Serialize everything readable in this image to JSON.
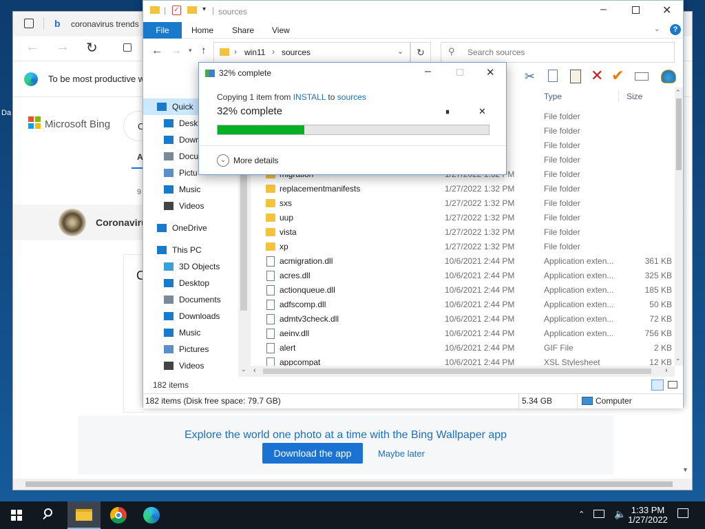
{
  "browser": {
    "tab_title": "coronavirus trends",
    "info_bar_text": "To be most productive w",
    "bing_logo_text": "Microsoft Bing",
    "search_peek": "C",
    "tab_peek": "Al",
    "count_peek": "9",
    "entity_text": "Coronaviru",
    "card_peek": "C",
    "banner_text": "Explore the world one photo at a time with the Bing Wallpaper app",
    "download_label": "Download the app",
    "maybe_later_label": "Maybe later",
    "desktop_label": "Da"
  },
  "explorer": {
    "title": "sources",
    "ribbon_tabs": [
      "File",
      "Home",
      "Share",
      "View"
    ],
    "breadcrumb": [
      "win11",
      "sources"
    ],
    "search_placeholder": "Search sources",
    "nav_items": [
      {
        "label": "Quick",
        "icon": "star-icon",
        "color": "#1979ca"
      },
      {
        "label": "Deskt",
        "icon": "desktop-icon",
        "color": "#1979ca"
      },
      {
        "label": "Down",
        "icon": "download-icon",
        "color": "#1979ca"
      },
      {
        "label": "Docu",
        "icon": "documents-icon",
        "color": "#7a8a9a"
      },
      {
        "label": "Pictu",
        "icon": "pictures-icon",
        "color": "#5b8fc7"
      },
      {
        "label": "Music",
        "icon": "music-icon",
        "color": "#1979ca"
      },
      {
        "label": "Videos",
        "icon": "videos-icon",
        "color": "#444"
      },
      {
        "label": "OneDrive",
        "icon": "onedrive-icon",
        "color": "#1979ca"
      },
      {
        "label": "This PC",
        "icon": "this-pc-icon",
        "color": "#1979ca"
      },
      {
        "label": "3D Objects",
        "icon": "3d-objects-icon",
        "color": "#3ba0d6"
      },
      {
        "label": "Desktop",
        "icon": "desktop-icon",
        "color": "#1979ca"
      },
      {
        "label": "Documents",
        "icon": "documents-icon",
        "color": "#7a8a9a"
      },
      {
        "label": "Downloads",
        "icon": "download-icon",
        "color": "#1979ca"
      },
      {
        "label": "Music",
        "icon": "music-icon",
        "color": "#1979ca"
      },
      {
        "label": "Pictures",
        "icon": "pictures-icon",
        "color": "#5b8fc7"
      },
      {
        "label": "Videos",
        "icon": "videos-icon",
        "color": "#444"
      }
    ],
    "columns": {
      "type": "Type",
      "size": "Size"
    },
    "rows": [
      {
        "name": "",
        "date": "",
        "type": "File folder",
        "size": "",
        "kind": "folder"
      },
      {
        "name": "",
        "date": "",
        "type": "File folder",
        "size": "",
        "kind": "folder"
      },
      {
        "name": "",
        "date": "",
        "type": "File folder",
        "size": "",
        "kind": "folder"
      },
      {
        "name": "",
        "date": "",
        "type": "File folder",
        "size": "",
        "kind": "folder"
      },
      {
        "name": "migration",
        "date": "1/27/2022 1:32 PM",
        "type": "File folder",
        "size": "",
        "kind": "folder"
      },
      {
        "name": "replacementmanifests",
        "date": "1/27/2022 1:32 PM",
        "type": "File folder",
        "size": "",
        "kind": "folder"
      },
      {
        "name": "sxs",
        "date": "1/27/2022 1:32 PM",
        "type": "File folder",
        "size": "",
        "kind": "folder"
      },
      {
        "name": "uup",
        "date": "1/27/2022 1:32 PM",
        "type": "File folder",
        "size": "",
        "kind": "folder"
      },
      {
        "name": "vista",
        "date": "1/27/2022 1:32 PM",
        "type": "File folder",
        "size": "",
        "kind": "folder"
      },
      {
        "name": "xp",
        "date": "1/27/2022 1:32 PM",
        "type": "File folder",
        "size": "",
        "kind": "folder"
      },
      {
        "name": "acmigration.dll",
        "date": "10/6/2021 2:44 PM",
        "type": "Application exten...",
        "size": "361 KB",
        "kind": "dll"
      },
      {
        "name": "acres.dll",
        "date": "10/6/2021 2:44 PM",
        "type": "Application exten...",
        "size": "325 KB",
        "kind": "dll"
      },
      {
        "name": "actionqueue.dll",
        "date": "10/6/2021 2:44 PM",
        "type": "Application exten...",
        "size": "185 KB",
        "kind": "dll"
      },
      {
        "name": "adfscomp.dll",
        "date": "10/6/2021 2:44 PM",
        "type": "Application exten...",
        "size": "50 KB",
        "kind": "dll"
      },
      {
        "name": "admtv3check.dll",
        "date": "10/6/2021 2:44 PM",
        "type": "Application exten...",
        "size": "72 KB",
        "kind": "dll"
      },
      {
        "name": "aeinv.dll",
        "date": "10/6/2021 2:44 PM",
        "type": "Application exten...",
        "size": "756 KB",
        "kind": "dll"
      },
      {
        "name": "alert",
        "date": "10/6/2021 2:44 PM",
        "type": "GIF File",
        "size": "2 KB",
        "kind": "gif"
      },
      {
        "name": "appcompat",
        "date": "10/6/2021 2:44 PM",
        "type": "XSL Stylesheet",
        "size": "12 KB",
        "kind": "xsl"
      }
    ],
    "item_count": "182 items",
    "status_free": "182 items (Disk free space: 79.7 GB)",
    "status_size": "5.34 GB",
    "status_location": "Computer"
  },
  "copy_dialog": {
    "title": "32% complete",
    "source_prefix": "Copying 1 item from ",
    "source": "INSTALL",
    "to_word": " to ",
    "destination": "sources",
    "percent_text": "32% complete",
    "progress": 0.32,
    "more_details": "More details"
  },
  "taskbar": {
    "time": "1:33 PM",
    "date": "1/27/2022"
  },
  "colors": {
    "accent": "#1979ca",
    "progress": "#06b025",
    "link": "#1a6fbf"
  }
}
